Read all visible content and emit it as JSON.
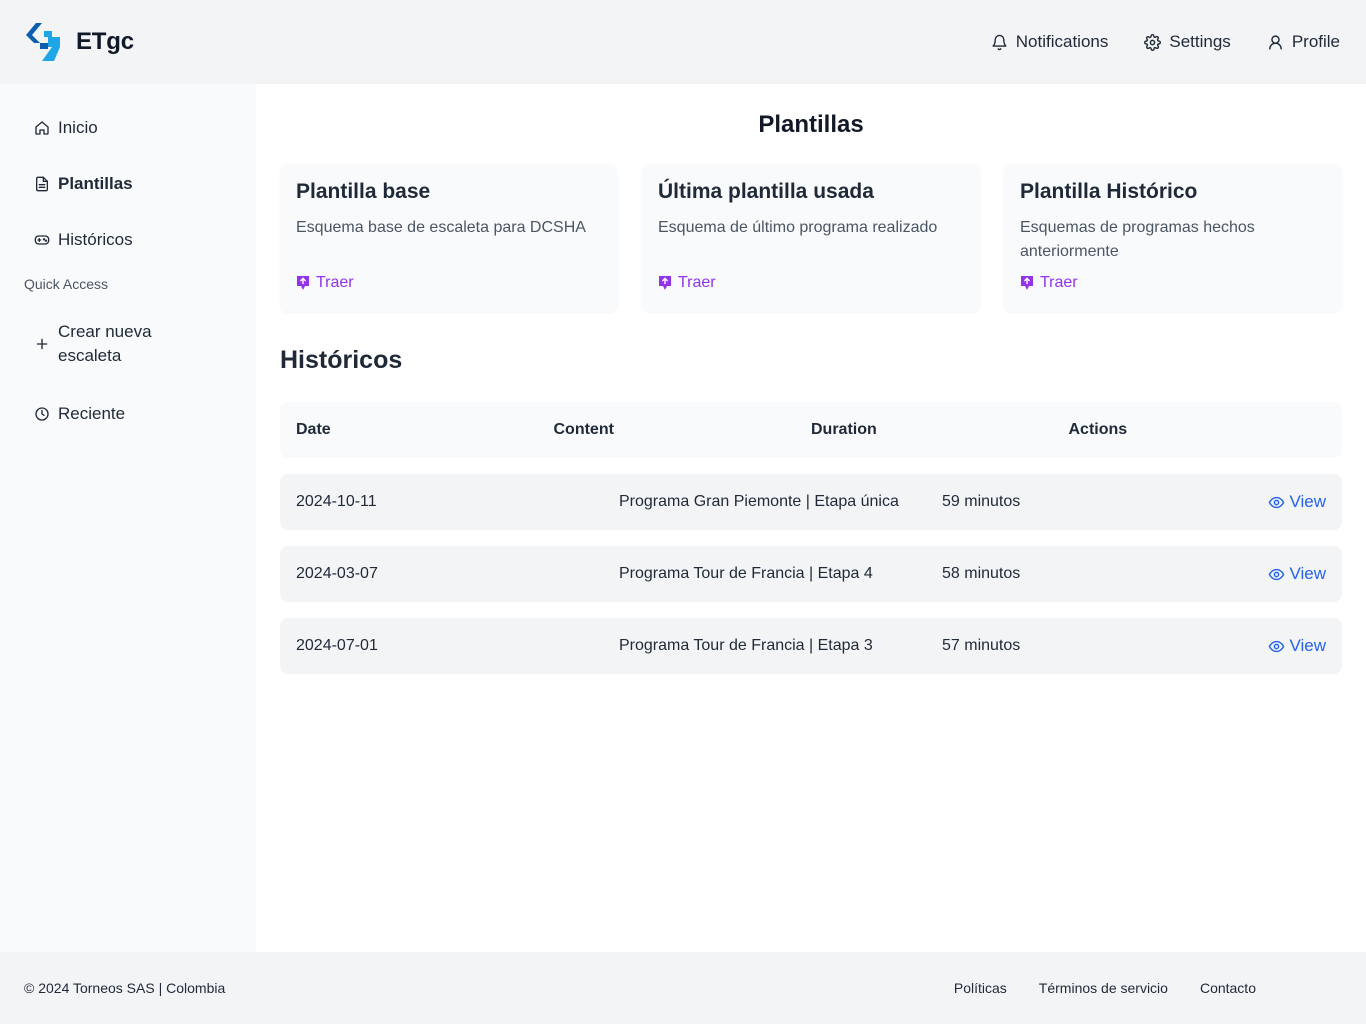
{
  "brand": {
    "name": "ETgc",
    "colors": {
      "primary": "#0b5fb0",
      "secondary": "#1fa6e6"
    }
  },
  "topnav": [
    {
      "label": "Notifications",
      "icon": "bell-icon"
    },
    {
      "label": "Settings",
      "icon": "gear-icon"
    },
    {
      "label": "Profile",
      "icon": "user-icon"
    }
  ],
  "sidebar": {
    "items": [
      {
        "label": "Inicio",
        "icon": "home-icon"
      },
      {
        "label": "Plantillas",
        "icon": "document-icon",
        "active": true
      },
      {
        "label": "Históricos",
        "icon": "gamepad-icon"
      }
    ],
    "section_label": "Quick Access",
    "quick": [
      {
        "label": "Crear nueva escaleta",
        "icon": "plus-icon"
      },
      {
        "label": "Reciente",
        "icon": "clock-icon"
      }
    ]
  },
  "main": {
    "title": "Plantillas",
    "cards": [
      {
        "title": "Plantilla base",
        "description": "Esquema base de escaleta para DCSHA",
        "link": "Traer"
      },
      {
        "title": "Última plantilla usada",
        "description": "Esquema de último programa realizado",
        "link": "Traer"
      },
      {
        "title": "Plantilla Histórico",
        "description": "Esquemas de programas hechos anteriormente",
        "link": "Traer"
      }
    ],
    "historicos_title": "Históricos",
    "table": {
      "headers": [
        "Date",
        "Content",
        "Duration",
        "Actions"
      ],
      "rows": [
        {
          "date": "2024-10-11",
          "content": "Programa Gran Piemonte | Etapa única",
          "duration": "59 minutos",
          "action": "View"
        },
        {
          "date": "2024-03-07",
          "content": "Programa Tour de Francia | Etapa 4",
          "duration": "58 minutos",
          "action": "View"
        },
        {
          "date": "2024-07-01",
          "content": "Programa Tour de Francia | Etapa 3",
          "duration": "57 minutos",
          "action": "View"
        }
      ]
    }
  },
  "footer": {
    "copyright": "© 2024 Torneos SAS | Colombia",
    "links": [
      "Políticas",
      "Términos de servicio",
      "Contacto"
    ]
  }
}
